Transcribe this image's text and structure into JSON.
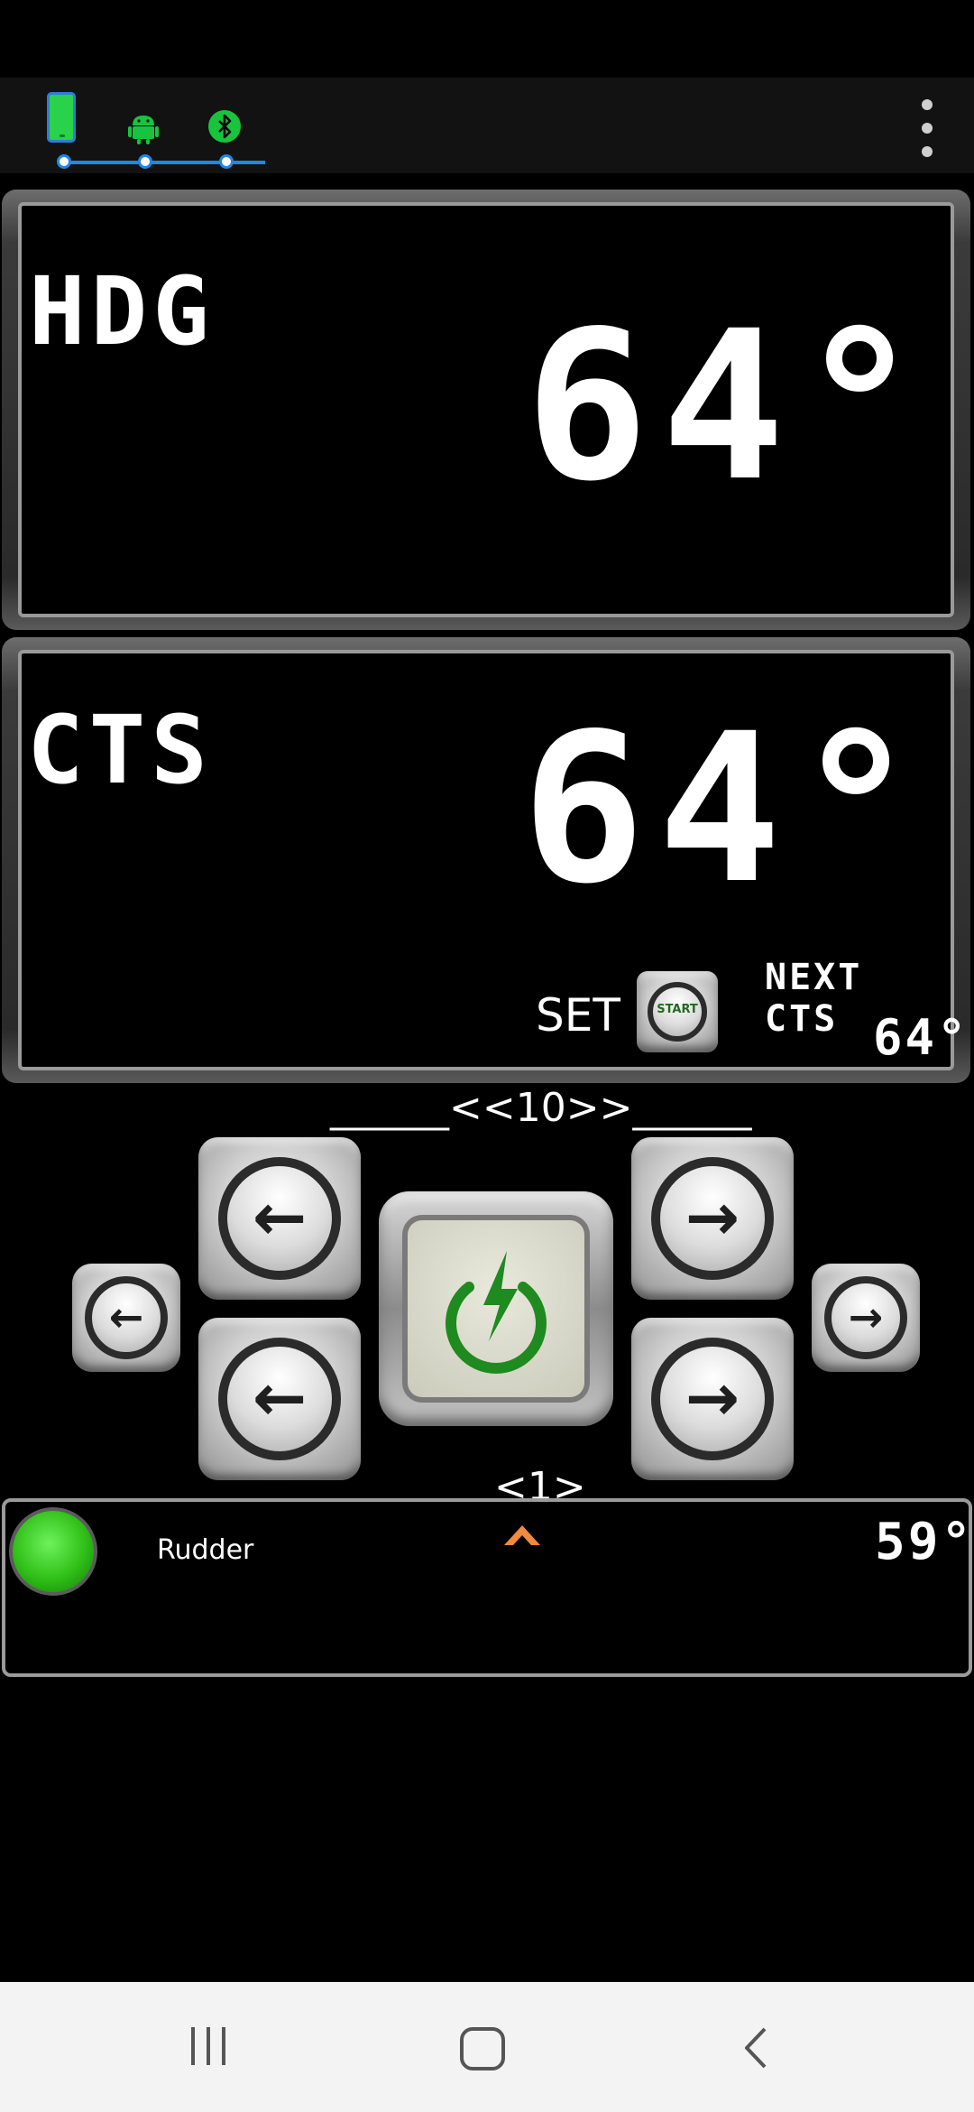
{
  "status_bar": {
    "connection_icons": [
      "phone-icon",
      "android-icon",
      "bluetooth-icon"
    ],
    "menu_icon": "more-vert-icon",
    "colors": {
      "link_line": "#1e88e5",
      "icon_green": "#18c43d"
    }
  },
  "heading_panel": {
    "label": "HDG",
    "value": "64°"
  },
  "course_panel": {
    "label": "CTS",
    "value": "64°",
    "set_label": "SET",
    "start_button_label": "START",
    "next_label": "NEXT CTS",
    "next_value": "64°"
  },
  "controls": {
    "large_step_label": "______<<10>>______",
    "small_step_label": "________<1>_______",
    "buttons": {
      "left_small": "arrow-left-icon",
      "left_large_top": "arrow-left-icon",
      "left_large_bottom": "arrow-left-icon",
      "power": "power-bolt-icon",
      "right_large_top": "arrow-right-icon",
      "right_large_bottom": "arrow-right-icon",
      "right_small": "arrow-right-icon"
    },
    "power_color": "#1f8a1f"
  },
  "rudder": {
    "label": "Rudder",
    "value": "59°",
    "status_color": "#2fbf17",
    "indicator_color": "#f08a3c"
  },
  "navbar": {
    "icons": [
      "recents-icon",
      "home-icon",
      "back-icon"
    ]
  }
}
